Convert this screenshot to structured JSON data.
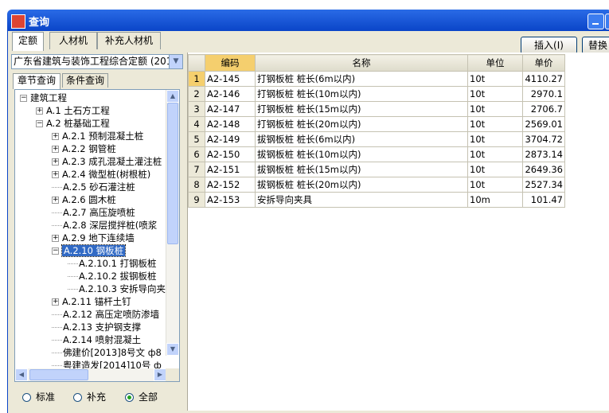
{
  "window": {
    "title": "查询"
  },
  "top_tabs": [
    {
      "label": "定额",
      "active": true
    },
    {
      "label": "人材机",
      "active": false
    },
    {
      "label": "补充人材机",
      "active": false
    }
  ],
  "toolbar": {
    "insert_label": "插入(I)",
    "replace_label": "替换"
  },
  "left": {
    "quota_select": "广东省建筑与装饰工程综合定额 (201",
    "subtabs": [
      {
        "label": "章节查询",
        "active": true
      },
      {
        "label": "条件查询",
        "active": false
      }
    ],
    "tree": [
      {
        "label": "建筑工程",
        "toggle": "−"
      },
      {
        "label": "A.1 土石方工程",
        "toggle": "+"
      },
      {
        "label": "A.2 桩基础工程",
        "toggle": "−"
      },
      {
        "label": "A.2.1 预制混凝土桩",
        "toggle": "+"
      },
      {
        "label": "A.2.2 钢管桩",
        "toggle": "+"
      },
      {
        "label": "A.2.3 成孔混凝土灌注桩",
        "toggle": "+"
      },
      {
        "label": "A.2.4 微型桩(树根桩)",
        "toggle": "+"
      },
      {
        "label": "A.2.5 砂石灌注桩",
        "toggle": ""
      },
      {
        "label": "A.2.6 圆木桩",
        "toggle": "+"
      },
      {
        "label": "A.2.7 高压旋喷桩",
        "toggle": ""
      },
      {
        "label": "A.2.8 深层搅拌桩(喷浆",
        "toggle": ""
      },
      {
        "label": "A.2.9 地下连续墙",
        "toggle": "+"
      },
      {
        "label": "A.2.10 钢板桩",
        "toggle": "−",
        "selected": true
      },
      {
        "label": "A.2.10.1 打钢板桩",
        "toggle": ""
      },
      {
        "label": "A.2.10.2 拔钢板桩",
        "toggle": ""
      },
      {
        "label": "A.2.10.3 安拆导向夹",
        "toggle": ""
      },
      {
        "label": "A.2.11 锚杆土钉",
        "toggle": "+"
      },
      {
        "label": "A.2.12 高压定喷防渗墙",
        "toggle": ""
      },
      {
        "label": "A.2.13 支护钢支撑",
        "toggle": ""
      },
      {
        "label": "A.2.14 喷射混凝土",
        "toggle": ""
      },
      {
        "label": "佛建价[2013]8号文 ф8",
        "toggle": ""
      },
      {
        "label": "粤建造发[2014]10号 ф",
        "toggle": ""
      }
    ],
    "radios": [
      {
        "label": "标准",
        "checked": false
      },
      {
        "label": "补充",
        "checked": false
      },
      {
        "label": "全部",
        "checked": true
      }
    ]
  },
  "grid": {
    "columns": [
      "编码",
      "名称",
      "单位",
      "单价"
    ],
    "rows": [
      {
        "num": "1",
        "code": "A2-145",
        "name": "打钢板桩 桩长(6m以内)",
        "unit": "10t",
        "price": "4110.27"
      },
      {
        "num": "2",
        "code": "A2-146",
        "name": "打钢板桩 桩长(10m以内)",
        "unit": "10t",
        "price": "2970.1"
      },
      {
        "num": "3",
        "code": "A2-147",
        "name": "打钢板桩 桩长(15m以内)",
        "unit": "10t",
        "price": "2706.7"
      },
      {
        "num": "4",
        "code": "A2-148",
        "name": "打钢板桩 桩长(20m以内)",
        "unit": "10t",
        "price": "2569.01"
      },
      {
        "num": "5",
        "code": "A2-149",
        "name": "拔钢板桩 桩长(6m以内)",
        "unit": "10t",
        "price": "3704.72"
      },
      {
        "num": "6",
        "code": "A2-150",
        "name": "拔钢板桩 桩长(10m以内)",
        "unit": "10t",
        "price": "2873.14"
      },
      {
        "num": "7",
        "code": "A2-151",
        "name": "拔钢板桩 桩长(15m以内)",
        "unit": "10t",
        "price": "2649.36"
      },
      {
        "num": "8",
        "code": "A2-152",
        "name": "拔钢板桩 桩长(20m以内)",
        "unit": "10t",
        "price": "2527.34"
      },
      {
        "num": "9",
        "code": "A2-153",
        "name": "安拆导向夹具",
        "unit": "10m",
        "price": "101.47"
      }
    ]
  }
}
